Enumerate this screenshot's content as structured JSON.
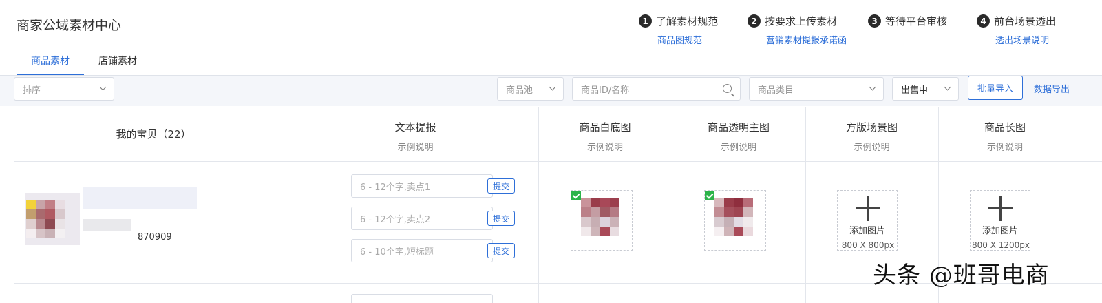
{
  "header": {
    "title": "商家公域素材中心"
  },
  "steps": [
    {
      "num": "1",
      "label": "了解素材规范",
      "link": "商品图规范"
    },
    {
      "num": "2",
      "label": "按要求上传素材",
      "link": "营销素材提报承诺函"
    },
    {
      "num": "3",
      "label": "等待平台审核",
      "link": ""
    },
    {
      "num": "4",
      "label": "前台场景透出",
      "link": "透出场景说明"
    }
  ],
  "tabs": [
    {
      "label": "商品素材",
      "active": true
    },
    {
      "label": "店铺素材",
      "active": false
    }
  ],
  "filters": {
    "sort": "排序",
    "pool": "商品池",
    "search_placeholder": "商品ID/名称",
    "category": "商品类目",
    "status": "出售中",
    "batch_import": "批量导入",
    "export": "数据导出"
  },
  "table": {
    "columns": [
      {
        "title": "我的宝贝（22）",
        "sub": ""
      },
      {
        "title": "文本提报",
        "sub": "示例说明"
      },
      {
        "title": "商品白底图",
        "sub": "示例说明"
      },
      {
        "title": "商品透明主图",
        "sub": "示例说明"
      },
      {
        "title": "方版场景图",
        "sub": "示例说明"
      },
      {
        "title": "商品长图",
        "sub": "示例说明"
      }
    ],
    "row": {
      "product_id": "870909",
      "text_inputs": [
        {
          "placeholder": "6 - 12个字,卖点1",
          "submit": "提交"
        },
        {
          "placeholder": "6 - 12个字,卖点2",
          "submit": "提交"
        },
        {
          "placeholder": "6 - 10个字,短标题",
          "submit": "提交"
        }
      ],
      "square_scene": {
        "label": "添加图片",
        "size": "800 X 800px"
      },
      "long_image": {
        "label": "添加图片",
        "size": "800 X 1200px"
      }
    }
  },
  "watermark": "头条 @班哥电商"
}
